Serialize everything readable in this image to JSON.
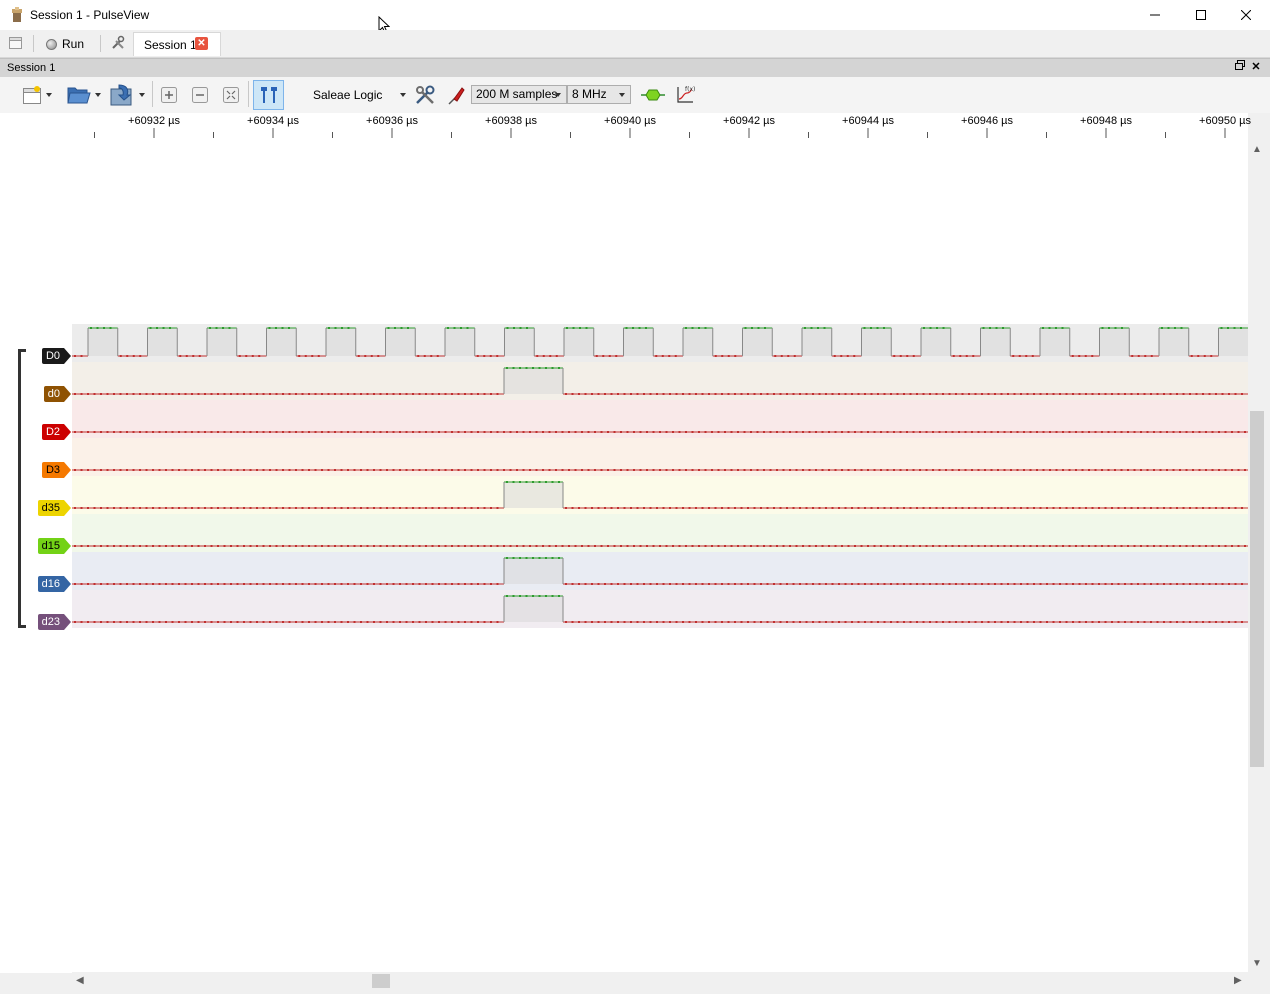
{
  "window": {
    "title": "Session 1 - PulseView"
  },
  "tabbar": {
    "run_label": "Run",
    "session_tab_label": "Session 1"
  },
  "dock": {
    "title": "Session 1"
  },
  "toolbar": {
    "device": "Saleae Logic",
    "samples": "200 M samples",
    "rate": "8 MHz"
  },
  "ruler": {
    "ticks": [
      "+60932 µs",
      "+60934 µs",
      "+60936 µs",
      "+60938 µs",
      "+60940 µs",
      "+60942 µs",
      "+60944 µs",
      "+60946 µs",
      "+60948 µs",
      "+60950 µs"
    ]
  },
  "channels": [
    {
      "name": "D0",
      "color": "#1a1a1a",
      "text_color": "#ffffff",
      "row_bg": "#ececec",
      "pattern": "clock"
    },
    {
      "name": "d0",
      "color": "#8f5202",
      "text_color": "#ffffff",
      "row_bg": "#f3efe8",
      "pattern": "pulse"
    },
    {
      "name": "D2",
      "color": "#cc0000",
      "text_color": "#ffffff",
      "row_bg": "#f9e9e9",
      "pattern": "low"
    },
    {
      "name": "D3",
      "color": "#f57900",
      "text_color": "#000000",
      "row_bg": "#fbf1e8",
      "pattern": "low"
    },
    {
      "name": "d35",
      "color": "#edd400",
      "text_color": "#000000",
      "row_bg": "#fcfbe9",
      "pattern": "pulse"
    },
    {
      "name": "d15",
      "color": "#73d216",
      "text_color": "#000000",
      "row_bg": "#f1f8ea",
      "pattern": "low"
    },
    {
      "name": "d16",
      "color": "#3465a4",
      "text_color": "#ffffff",
      "row_bg": "#e9ecf3",
      "pattern": "pulse"
    },
    {
      "name": "d23",
      "color": "#75507b",
      "text_color": "#ffffff",
      "row_bg": "#f1ecf1",
      "pattern": "pulse"
    }
  ],
  "colors": {
    "high": "#2e9b2e",
    "low": "#c03030",
    "edge": "#888888",
    "fill": "#d8d8d8"
  }
}
